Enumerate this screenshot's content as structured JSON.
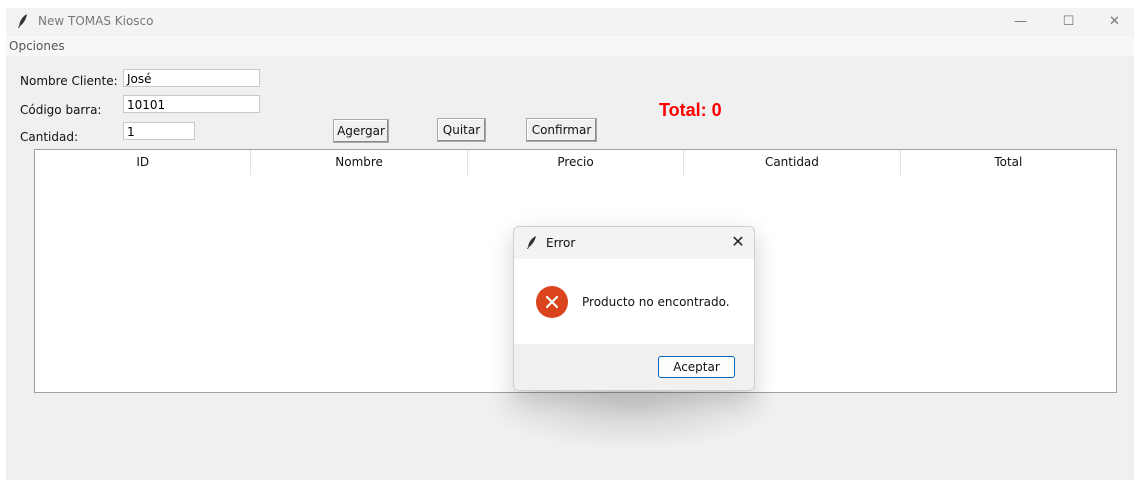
{
  "window": {
    "title": "New TOMAS Kiosco",
    "controls": {
      "minimize": "—",
      "maximize": "☐",
      "close": "✕"
    },
    "menu": [
      "Opciones"
    ]
  },
  "form": {
    "cliente_label": "Nombre Cliente:",
    "cliente_value": "José",
    "codigo_label": "Código barra:",
    "codigo_value": "10101",
    "cantidad_label": "Cantidad:",
    "cantidad_value": "1"
  },
  "buttons": {
    "agregar": "Agergar",
    "quitar": "Quitar",
    "confirmar": "Confirmar"
  },
  "total_label": "Total: 0",
  "table": {
    "columns": [
      "ID",
      "Nombre",
      "Precio",
      "Cantidad",
      "Total"
    ],
    "rows": []
  },
  "dialog": {
    "title": "Error",
    "close": "✕",
    "message": "Producto no encontrado.",
    "ok_label": "Aceptar",
    "icon": "error-icon",
    "icon_color": "#d9441c"
  },
  "colors": {
    "total_text": "#ff0000",
    "button_focus_border": "#0067c0"
  }
}
